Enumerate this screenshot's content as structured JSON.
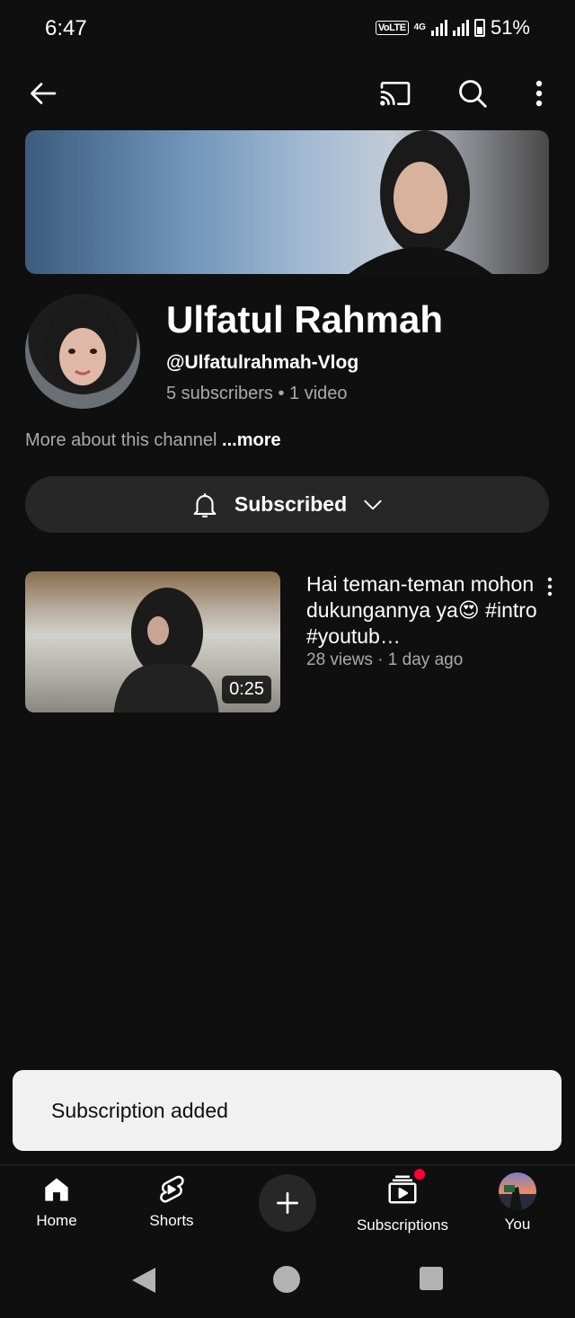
{
  "status_bar": {
    "time": "6:47",
    "volte": "VoLTE",
    "network": "4G",
    "battery": "51%"
  },
  "channel": {
    "name": "Ulfatul Rahmah",
    "handle": "@Ulfatulrahmah-Vlog",
    "stats": "5 subscribers • 1 video",
    "about": "More about this channel",
    "about_more": "...more",
    "subscribe_label": "Subscribed"
  },
  "video": {
    "title": "Hai teman-teman mohon dukungannya ya😍 #intro #youtub…",
    "meta": "28 views · 1 day ago",
    "duration": "0:25"
  },
  "snackbar": {
    "message": "Subscription added"
  },
  "bottom_nav": {
    "home": "Home",
    "shorts": "Shorts",
    "subscriptions": "Subscriptions",
    "you": "You"
  },
  "icons": {
    "back": "arrow-left-icon",
    "cast": "cast-icon",
    "search": "search-icon",
    "more": "more-vert-icon",
    "bell": "bell-icon",
    "chevron": "chevron-down-icon",
    "home": "home-icon",
    "shorts": "shorts-icon",
    "create": "plus-icon",
    "subscriptions": "subscriptions-icon"
  },
  "colors": {
    "background": "#0f0f0f",
    "surface": "#272727",
    "text_secondary": "#aaaaaa",
    "snackbar": "#f1f1f1",
    "notification": "#ff0033"
  }
}
